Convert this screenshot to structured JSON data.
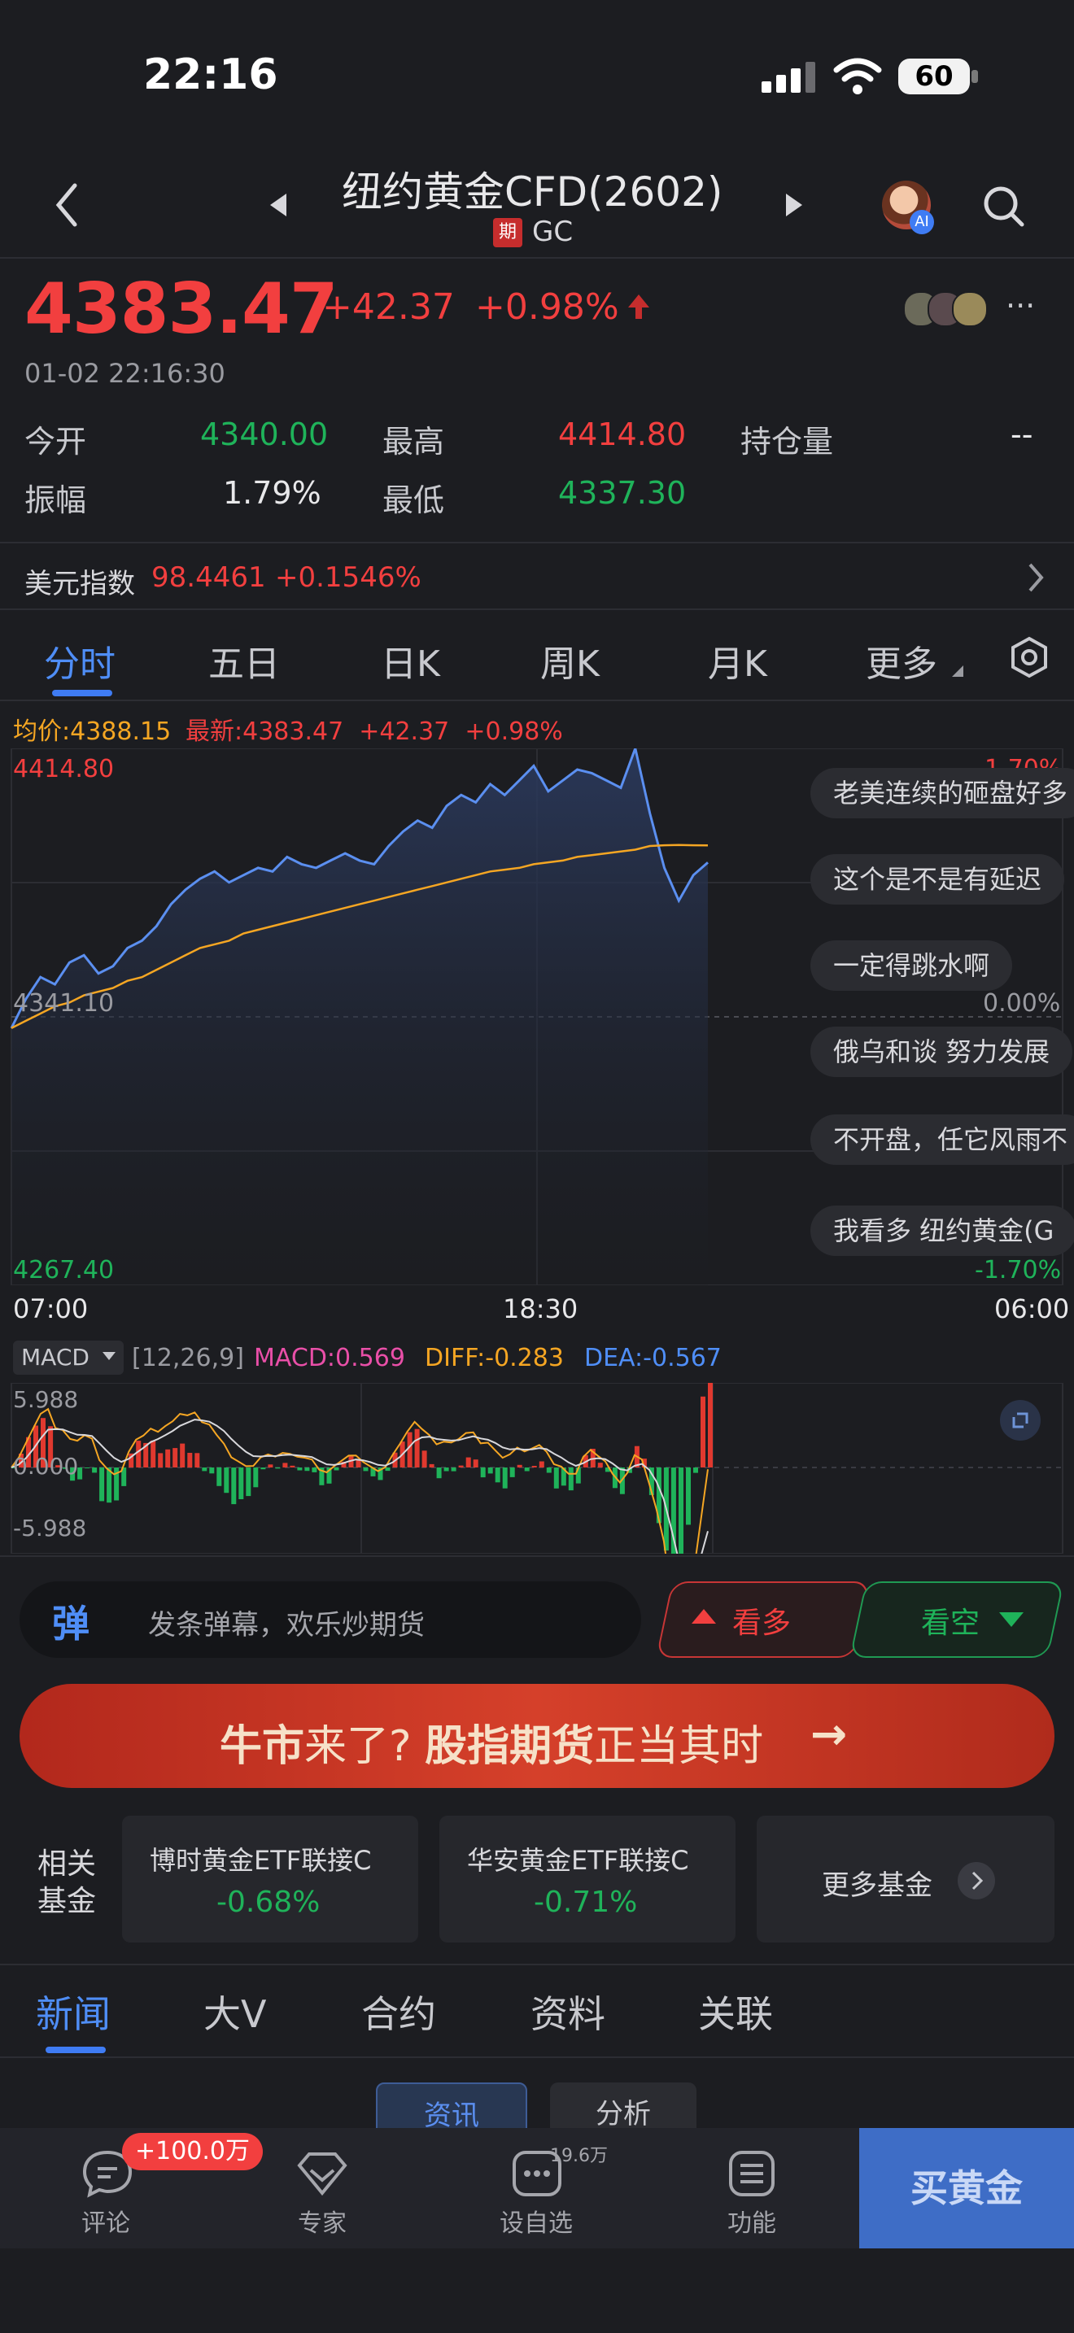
{
  "status": {
    "time": "22:16",
    "battery": "60"
  },
  "header": {
    "title": "纽约黄金CFD(2602)",
    "badge": "期",
    "code": "GC",
    "ai_badge": "AI"
  },
  "quote": {
    "price": "4383.47",
    "change": "+42.37",
    "change_pct": "+0.98%",
    "time": "01-02 22:16:30",
    "stats": [
      {
        "label": "今开",
        "value": "4340.00",
        "color": "green"
      },
      {
        "label": "最高",
        "value": "4414.80",
        "color": "red"
      },
      {
        "label": "持仓量",
        "value": "--",
        "color": "white"
      },
      {
        "label": "振幅",
        "value": "1.79%",
        "color": "white"
      },
      {
        "label": "最低",
        "value": "4337.30",
        "color": "green"
      }
    ]
  },
  "usd_index": {
    "label": "美元指数",
    "value": "98.4461",
    "pct": "+0.1546%"
  },
  "tabs": [
    "分时",
    "五日",
    "日K",
    "周K",
    "月K",
    "更多"
  ],
  "chart_labels": {
    "avg": "均价:4388.15",
    "latest": "最新:4383.47",
    "latest_change": "+42.37",
    "latest_pct": "+0.98%",
    "y_high": "4414.80",
    "y_mid": "4341.10",
    "y_low": "4267.40",
    "pct_high": "1.70%",
    "pct_mid": "0.00%",
    "pct_low": "-1.70%",
    "x_ticks": [
      "07:00",
      "18:30",
      "06:00"
    ]
  },
  "macd": {
    "selector": "MACD",
    "params": "[12,26,9]",
    "macd": "MACD:0.569",
    "diff": "DIFF:-0.283",
    "dea": "DEA:-0.567",
    "y_high": "5.988",
    "y_mid": "0.000",
    "y_low": "-5.988"
  },
  "comments": [
    "老美连续的砸盘好多",
    "这个是不是有延迟",
    "一定得跳水啊",
    "俄乌和谈   努力发展",
    "不开盘，任它风雨不",
    "我看多 纽约黄金(G"
  ],
  "danmu": {
    "icon": "弹",
    "placeholder": "发条弹幕，欢乐炒期货",
    "bull": "看多",
    "bear": "看空"
  },
  "banner": {
    "text_a": "牛市",
    "text_b": "来了? ",
    "text_c": "股指期货",
    "text_d": "正当其时"
  },
  "funds": {
    "label_line1": "相关",
    "label_line2": "基金",
    "items": [
      {
        "name": "博时黄金ETF联接C",
        "value": "-0.68%"
      },
      {
        "name": "华安黄金ETF联接C",
        "value": "-0.71%"
      }
    ],
    "more": "更多基金"
  },
  "news_tabs": [
    "新闻",
    "大V",
    "合约",
    "资料",
    "关联"
  ],
  "sub_tabs": [
    "资讯",
    "分析"
  ],
  "bottom_nav": {
    "comment": "评论",
    "comment_badge": "+100.0万",
    "expert": "专家",
    "watch": "设自选",
    "watch_count": "19.6万",
    "func": "功能",
    "buy": "买黄金"
  },
  "chart_data": {
    "type": "line",
    "title": "",
    "x_ticks": [
      "07:00",
      "18:30",
      "06:00"
    ],
    "ylim": [
      4267.4,
      4414.8
    ],
    "base": 4341.1,
    "series": [
      {
        "name": "最新",
        "color": "#5b8ff0",
        "values": [
          4338.0,
          4346,
          4352,
          4350,
          4356,
          4358,
          4353,
          4355,
          4360,
          4362,
          4366,
          4372,
          4376,
          4379,
          4381,
          4378,
          4380,
          4382,
          4381,
          4385,
          4383,
          4382,
          4384,
          4386,
          4384,
          4383,
          4388,
          4392,
          4395,
          4393,
          4399,
          4402,
          4400,
          4405,
          4402,
          4406,
          4410,
          4403,
          4406,
          4409,
          4408,
          4406,
          4404,
          4414.8,
          4397,
          4382,
          4373,
          4380,
          4383.47
        ]
      },
      {
        "name": "均价",
        "color": "#f5a623",
        "values": [
          4338.0,
          4340,
          4342,
          4344,
          4345,
          4347,
          4348,
          4349,
          4351,
          4352,
          4354,
          4356,
          4358,
          4360,
          4361,
          4362,
          4364,
          4365,
          4366,
          4367,
          4368,
          4369,
          4370,
          4371,
          4372,
          4373,
          4374,
          4375,
          4376,
          4377,
          4378,
          4379,
          4380,
          4381,
          4381.5,
          4382,
          4383,
          4383.5,
          4384,
          4385,
          4385.5,
          4386,
          4386.5,
          4387,
          4388,
          4388.2,
          4388.3,
          4388.2,
          4388.15
        ]
      }
    ]
  }
}
